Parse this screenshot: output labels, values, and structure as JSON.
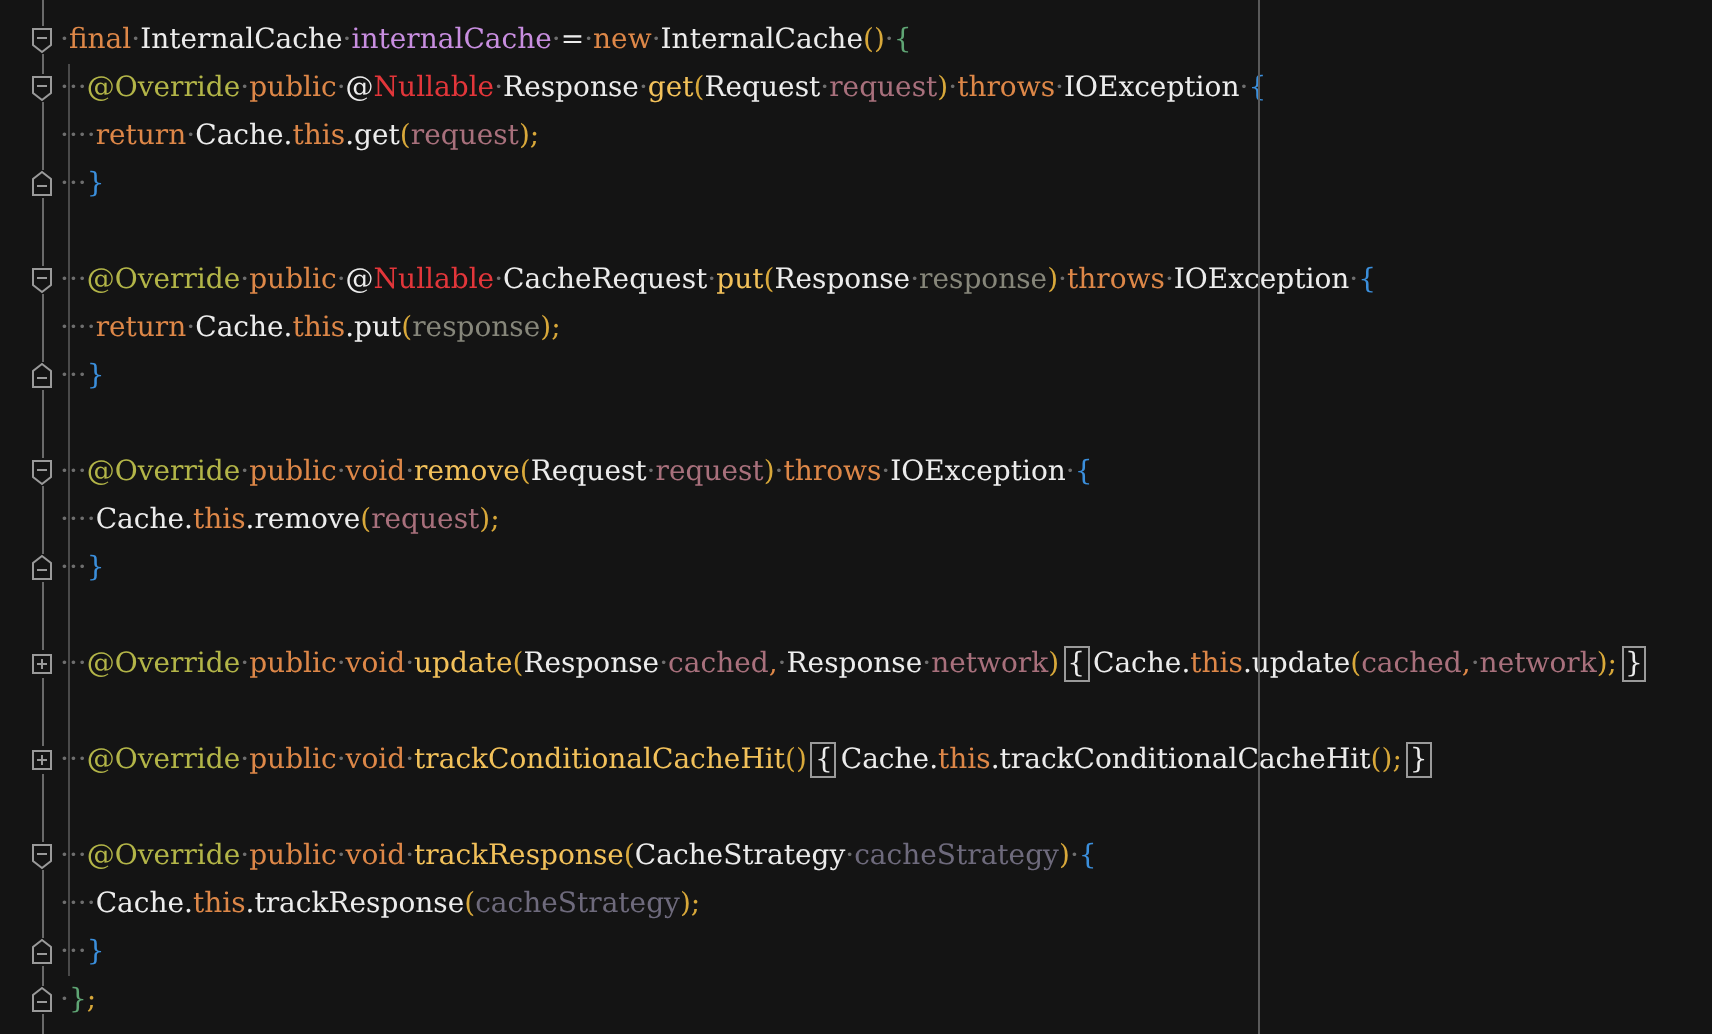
{
  "editor": {
    "lines": [
      {
        "kind": "fold-start",
        "tokens": [
          {
            "text": "·",
            "kind": "ws"
          },
          {
            "text": "final",
            "kind": "keyword"
          },
          {
            "text": "·",
            "kind": "ws"
          },
          {
            "text": "InternalCache",
            "kind": "plain"
          },
          {
            "text": "·",
            "kind": "ws"
          },
          {
            "text": "internalCache",
            "kind": "field"
          },
          {
            "text": "·",
            "kind": "ws"
          },
          {
            "text": "=",
            "kind": "plain"
          },
          {
            "text": "·",
            "kind": "ws"
          },
          {
            "text": "new",
            "kind": "keyword"
          },
          {
            "text": "·",
            "kind": "ws"
          },
          {
            "text": "InternalCache",
            "kind": "plain"
          },
          {
            "text": "()",
            "kind": "paren"
          },
          {
            "text": "·",
            "kind": "ws"
          },
          {
            "text": "{",
            "kind": "outer-brace"
          }
        ]
      },
      {
        "kind": "fold-start",
        "tokens": [
          {
            "text": "···",
            "kind": "ws"
          },
          {
            "text": "@Override",
            "kind": "annotation"
          },
          {
            "text": "·",
            "kind": "ws"
          },
          {
            "text": "public",
            "kind": "keyword"
          },
          {
            "text": "·",
            "kind": "ws"
          },
          {
            "text": "@",
            "kind": "plain"
          },
          {
            "text": "Nullable",
            "kind": "nullable"
          },
          {
            "text": "·",
            "kind": "ws"
          },
          {
            "text": "Response",
            "kind": "plain"
          },
          {
            "text": "·",
            "kind": "ws"
          },
          {
            "text": "get",
            "kind": "method"
          },
          {
            "text": "(",
            "kind": "paren"
          },
          {
            "text": "Request",
            "kind": "plain"
          },
          {
            "text": "·",
            "kind": "ws"
          },
          {
            "text": "request",
            "kind": "param"
          },
          {
            "text": ")",
            "kind": "paren"
          },
          {
            "text": "·",
            "kind": "ws"
          },
          {
            "text": "throws",
            "kind": "keyword"
          },
          {
            "text": "·",
            "kind": "ws"
          },
          {
            "text": "IOException",
            "kind": "plain"
          },
          {
            "text": "·",
            "kind": "ws"
          },
          {
            "text": "{",
            "kind": "brace"
          }
        ]
      },
      {
        "kind": "code",
        "tokens": [
          {
            "text": "····",
            "kind": "ws"
          },
          {
            "text": "return",
            "kind": "keyword"
          },
          {
            "text": "·",
            "kind": "ws"
          },
          {
            "text": "Cache.",
            "kind": "plain"
          },
          {
            "text": "this",
            "kind": "keyword"
          },
          {
            "text": ".get",
            "kind": "plain"
          },
          {
            "text": "(",
            "kind": "paren"
          },
          {
            "text": "request",
            "kind": "param"
          },
          {
            "text": ");",
            "kind": "paren"
          }
        ]
      },
      {
        "kind": "fold-end",
        "tokens": [
          {
            "text": "···",
            "kind": "ws"
          },
          {
            "text": "}",
            "kind": "brace"
          }
        ]
      },
      {
        "kind": "blank"
      },
      {
        "kind": "fold-start",
        "tokens": [
          {
            "text": "···",
            "kind": "ws"
          },
          {
            "text": "@Override",
            "kind": "annotation"
          },
          {
            "text": "·",
            "kind": "ws"
          },
          {
            "text": "public",
            "kind": "keyword"
          },
          {
            "text": "·",
            "kind": "ws"
          },
          {
            "text": "@",
            "kind": "plain"
          },
          {
            "text": "Nullable",
            "kind": "nullable"
          },
          {
            "text": "·",
            "kind": "ws"
          },
          {
            "text": "CacheRequest",
            "kind": "plain"
          },
          {
            "text": "·",
            "kind": "ws"
          },
          {
            "text": "put",
            "kind": "method"
          },
          {
            "text": "(",
            "kind": "paren"
          },
          {
            "text": "Response",
            "kind": "plain"
          },
          {
            "text": "·",
            "kind": "ws"
          },
          {
            "text": "response",
            "kind": "param-grey"
          },
          {
            "text": ")",
            "kind": "paren"
          },
          {
            "text": "·",
            "kind": "ws"
          },
          {
            "text": "throws",
            "kind": "keyword"
          },
          {
            "text": "·",
            "kind": "ws"
          },
          {
            "text": "IOException",
            "kind": "plain"
          },
          {
            "text": "·",
            "kind": "ws"
          },
          {
            "text": "{",
            "kind": "brace"
          }
        ]
      },
      {
        "kind": "code",
        "tokens": [
          {
            "text": "····",
            "kind": "ws"
          },
          {
            "text": "return",
            "kind": "keyword"
          },
          {
            "text": "·",
            "kind": "ws"
          },
          {
            "text": "Cache.",
            "kind": "plain"
          },
          {
            "text": "this",
            "kind": "keyword"
          },
          {
            "text": ".put",
            "kind": "plain"
          },
          {
            "text": "(",
            "kind": "paren"
          },
          {
            "text": "response",
            "kind": "param-grey"
          },
          {
            "text": ");",
            "kind": "paren"
          }
        ]
      },
      {
        "kind": "fold-end",
        "tokens": [
          {
            "text": "···",
            "kind": "ws"
          },
          {
            "text": "}",
            "kind": "brace"
          }
        ]
      },
      {
        "kind": "blank"
      },
      {
        "kind": "fold-start",
        "tokens": [
          {
            "text": "···",
            "kind": "ws"
          },
          {
            "text": "@Override",
            "kind": "annotation"
          },
          {
            "text": "·",
            "kind": "ws"
          },
          {
            "text": "public",
            "kind": "keyword"
          },
          {
            "text": "·",
            "kind": "ws"
          },
          {
            "text": "void",
            "kind": "keyword"
          },
          {
            "text": "·",
            "kind": "ws"
          },
          {
            "text": "remove",
            "kind": "method"
          },
          {
            "text": "(",
            "kind": "paren"
          },
          {
            "text": "Request",
            "kind": "plain"
          },
          {
            "text": "·",
            "kind": "ws"
          },
          {
            "text": "request",
            "kind": "param"
          },
          {
            "text": ")",
            "kind": "paren"
          },
          {
            "text": "·",
            "kind": "ws"
          },
          {
            "text": "throws",
            "kind": "keyword"
          },
          {
            "text": "·",
            "kind": "ws"
          },
          {
            "text": "IOException",
            "kind": "plain"
          },
          {
            "text": "·",
            "kind": "ws"
          },
          {
            "text": "{",
            "kind": "brace"
          }
        ]
      },
      {
        "kind": "code",
        "tokens": [
          {
            "text": "····",
            "kind": "ws"
          },
          {
            "text": "Cache.",
            "kind": "plain"
          },
          {
            "text": "this",
            "kind": "keyword"
          },
          {
            "text": ".remove",
            "kind": "plain"
          },
          {
            "text": "(",
            "kind": "paren"
          },
          {
            "text": "request",
            "kind": "param"
          },
          {
            "text": ");",
            "kind": "paren"
          }
        ]
      },
      {
        "kind": "fold-end",
        "tokens": [
          {
            "text": "···",
            "kind": "ws"
          },
          {
            "text": "}",
            "kind": "brace"
          }
        ]
      },
      {
        "kind": "blank"
      },
      {
        "kind": "folded",
        "tokens": [
          {
            "text": "···",
            "kind": "ws"
          },
          {
            "text": "@Override",
            "kind": "annotation"
          },
          {
            "text": "·",
            "kind": "ws"
          },
          {
            "text": "public",
            "kind": "keyword"
          },
          {
            "text": "·",
            "kind": "ws"
          },
          {
            "text": "void",
            "kind": "keyword"
          },
          {
            "text": "·",
            "kind": "ws"
          },
          {
            "text": "update",
            "kind": "method"
          },
          {
            "text": "(",
            "kind": "paren"
          },
          {
            "text": "Response",
            "kind": "plain"
          },
          {
            "text": "·",
            "kind": "ws"
          },
          {
            "text": "cached",
            "kind": "param"
          },
          {
            "text": ",",
            "kind": "keyword"
          },
          {
            "text": "·",
            "kind": "ws"
          },
          {
            "text": "Response",
            "kind": "plain"
          },
          {
            "text": "·",
            "kind": "ws"
          },
          {
            "text": "network",
            "kind": "param"
          },
          {
            "text": ")",
            "kind": "paren"
          },
          {
            "text": "{",
            "kind": "folded-brace"
          },
          {
            "text": "Cache.",
            "kind": "plain"
          },
          {
            "text": "this",
            "kind": "keyword"
          },
          {
            "text": ".update",
            "kind": "plain"
          },
          {
            "text": "(",
            "kind": "paren"
          },
          {
            "text": "cached",
            "kind": "param"
          },
          {
            "text": ",",
            "kind": "keyword"
          },
          {
            "text": "·",
            "kind": "ws"
          },
          {
            "text": "network",
            "kind": "param"
          },
          {
            "text": ");",
            "kind": "paren"
          },
          {
            "text": "}",
            "kind": "folded-brace"
          }
        ]
      },
      {
        "kind": "blank"
      },
      {
        "kind": "folded",
        "tokens": [
          {
            "text": "···",
            "kind": "ws"
          },
          {
            "text": "@Override",
            "kind": "annotation"
          },
          {
            "text": "·",
            "kind": "ws"
          },
          {
            "text": "public",
            "kind": "keyword"
          },
          {
            "text": "·",
            "kind": "ws"
          },
          {
            "text": "void",
            "kind": "keyword"
          },
          {
            "text": "·",
            "kind": "ws"
          },
          {
            "text": "trackConditionalCacheHit",
            "kind": "method"
          },
          {
            "text": "()",
            "kind": "paren"
          },
          {
            "text": "{",
            "kind": "folded-brace"
          },
          {
            "text": "Cache.",
            "kind": "plain"
          },
          {
            "text": "this",
            "kind": "keyword"
          },
          {
            "text": ".trackConditionalCacheHit",
            "kind": "plain"
          },
          {
            "text": "();",
            "kind": "paren"
          },
          {
            "text": "}",
            "kind": "folded-brace"
          }
        ]
      },
      {
        "kind": "blank"
      },
      {
        "kind": "fold-start",
        "tokens": [
          {
            "text": "···",
            "kind": "ws"
          },
          {
            "text": "@Override",
            "kind": "annotation"
          },
          {
            "text": "·",
            "kind": "ws"
          },
          {
            "text": "public",
            "kind": "keyword"
          },
          {
            "text": "·",
            "kind": "ws"
          },
          {
            "text": "void",
            "kind": "keyword"
          },
          {
            "text": "·",
            "kind": "ws"
          },
          {
            "text": "trackResponse",
            "kind": "method"
          },
          {
            "text": "(",
            "kind": "paren"
          },
          {
            "text": "CacheStrategy",
            "kind": "plain"
          },
          {
            "text": "·",
            "kind": "ws"
          },
          {
            "text": "cacheStrategy",
            "kind": "param-dim"
          },
          {
            "text": ")",
            "kind": "paren"
          },
          {
            "text": "·",
            "kind": "ws"
          },
          {
            "text": "{",
            "kind": "brace"
          }
        ]
      },
      {
        "kind": "code",
        "tokens": [
          {
            "text": "····",
            "kind": "ws"
          },
          {
            "text": "Cache.",
            "kind": "plain"
          },
          {
            "text": "this",
            "kind": "keyword"
          },
          {
            "text": ".trackResponse",
            "kind": "plain"
          },
          {
            "text": "(",
            "kind": "paren"
          },
          {
            "text": "cacheStrategy",
            "kind": "param-dim"
          },
          {
            "text": ");",
            "kind": "paren"
          }
        ]
      },
      {
        "kind": "fold-end",
        "tokens": [
          {
            "text": "···",
            "kind": "ws"
          },
          {
            "text": "}",
            "kind": "brace"
          }
        ]
      },
      {
        "kind": "fold-end",
        "tokens": [
          {
            "text": "·",
            "kind": "ws"
          },
          {
            "text": "}",
            "kind": "outer-brace"
          },
          {
            "text": ";",
            "kind": "paren"
          }
        ]
      }
    ]
  }
}
